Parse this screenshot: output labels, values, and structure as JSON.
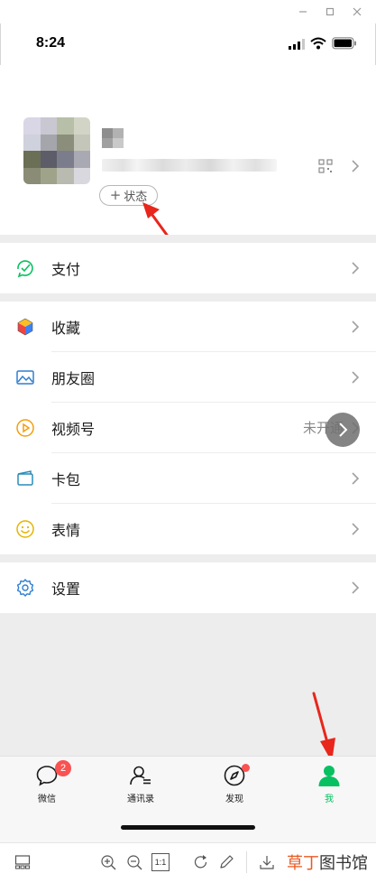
{
  "status_bar": {
    "time": "8:24"
  },
  "profile": {
    "status_button_label": "状态"
  },
  "menu": {
    "pay": {
      "label": "支付",
      "icon": "pay-icon"
    },
    "favorites": {
      "label": "收藏",
      "icon": "favorites-icon"
    },
    "moments": {
      "label": "朋友圈",
      "icon": "moments-icon"
    },
    "channels": {
      "label": "视频号",
      "icon": "channels-icon",
      "value": "未开通"
    },
    "cards": {
      "label": "卡包",
      "icon": "card-wallet-icon"
    },
    "stickers": {
      "label": "表情",
      "icon": "sticker-icon"
    },
    "settings": {
      "label": "设置",
      "icon": "gear-icon"
    }
  },
  "tabs": [
    {
      "label": "微信",
      "icon": "chat-icon",
      "badge": "2"
    },
    {
      "label": "通讯录",
      "icon": "contacts-icon"
    },
    {
      "label": "发现",
      "icon": "discover-icon",
      "dot": true
    },
    {
      "label": "我",
      "icon": "me-icon",
      "active": true
    }
  ],
  "viewer_toolbar": {
    "zoom_actual_label": "1:1",
    "brand_part1": "草丁",
    "brand_part2": "图书馆"
  },
  "colors": {
    "accent_green": "#07c160",
    "badge_red": "#fa5151",
    "annotation_red": "#e8261c",
    "brand_orange": "#e85a24"
  }
}
